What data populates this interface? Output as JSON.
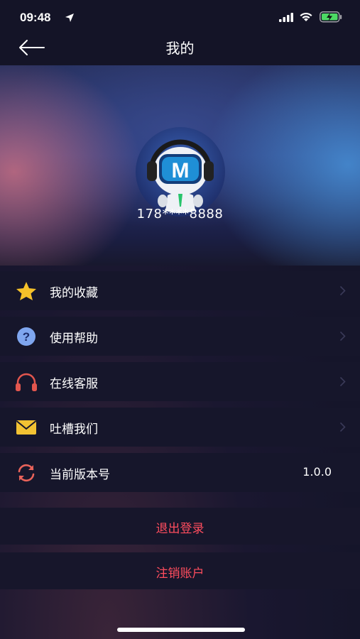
{
  "status": {
    "time": "09:48"
  },
  "nav": {
    "title": "我的"
  },
  "profile": {
    "phone": "178****8888"
  },
  "menu": [
    {
      "label": "我的收藏",
      "icon": "star-icon",
      "color": "#f5c12a"
    },
    {
      "label": "使用帮助",
      "icon": "question-icon",
      "color": "#7fa6ef"
    },
    {
      "label": "在线客服",
      "icon": "headphones-icon",
      "color": "#e2564e"
    },
    {
      "label": "吐槽我们",
      "icon": "envelope-icon",
      "color": "#f2c233"
    },
    {
      "label": "当前版本号",
      "icon": "refresh-icon",
      "color": "#e9635a",
      "value": "1.0.0"
    }
  ],
  "actions": {
    "logout": "退出登录",
    "cancel_account": "注销账户"
  },
  "colors": {
    "accent_red": "#ff4d5e",
    "background": "#16162a"
  }
}
